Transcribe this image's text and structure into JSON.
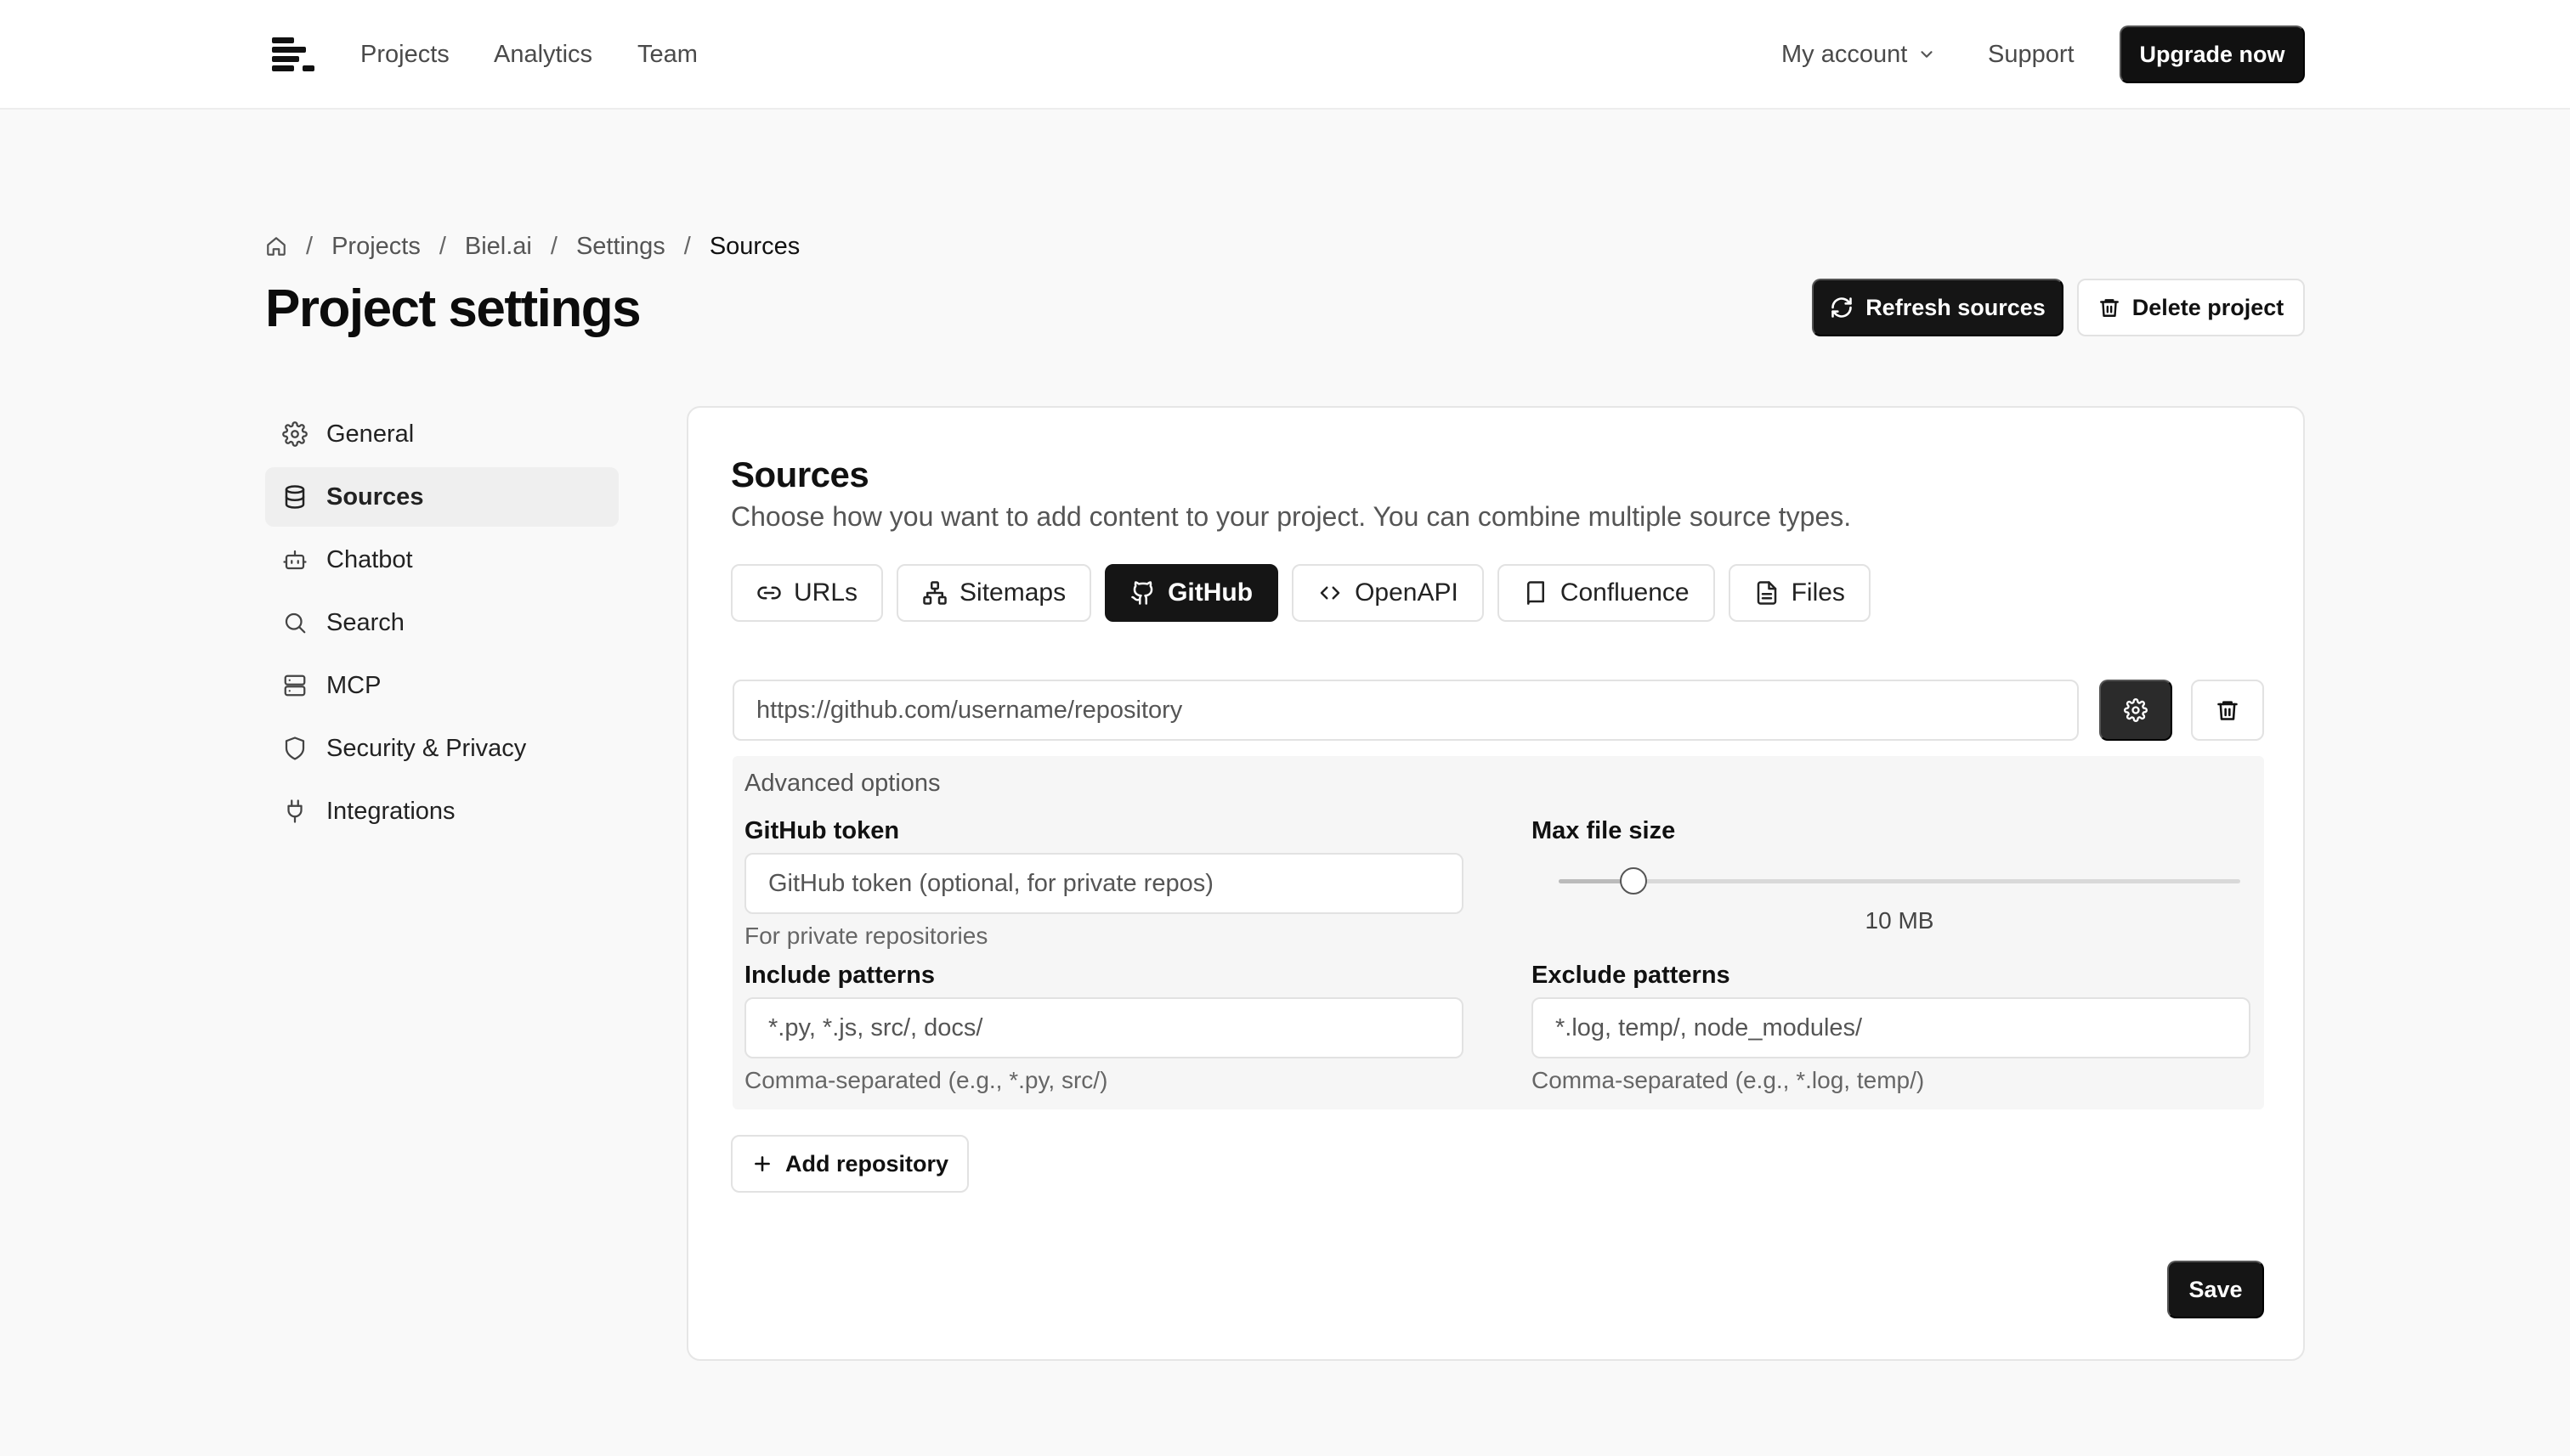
{
  "topnav": {
    "logo_icon": "menu-lines-logo",
    "links": [
      "Projects",
      "Analytics",
      "Team"
    ],
    "account_label": "My account",
    "support_label": "Support",
    "upgrade_label": "Upgrade now"
  },
  "breadcrumb": {
    "home_icon": "home-icon",
    "items": [
      "Projects",
      "Biel.ai",
      "Settings",
      "Sources"
    ]
  },
  "page": {
    "title": "Project settings",
    "refresh_label": "Refresh sources",
    "delete_label": "Delete project"
  },
  "sidebar": {
    "items": [
      {
        "label": "General",
        "icon": "gear-icon"
      },
      {
        "label": "Sources",
        "icon": "database-icon",
        "active": true
      },
      {
        "label": "Chatbot",
        "icon": "bot-icon"
      },
      {
        "label": "Search",
        "icon": "search-icon"
      },
      {
        "label": "MCP",
        "icon": "server-icon"
      },
      {
        "label": "Security & Privacy",
        "icon": "shield-icon"
      },
      {
        "label": "Integrations",
        "icon": "plug-icon"
      }
    ]
  },
  "sources": {
    "title": "Sources",
    "description": "Choose how you want to add content to your project. You can combine multiple source types.",
    "tabs": [
      {
        "label": "URLs",
        "icon": "link-icon"
      },
      {
        "label": "Sitemaps",
        "icon": "sitemap-icon"
      },
      {
        "label": "GitHub",
        "icon": "github-icon",
        "active": true
      },
      {
        "label": "OpenAPI",
        "icon": "code-icon"
      },
      {
        "label": "Confluence",
        "icon": "book-icon"
      },
      {
        "label": "Files",
        "icon": "file-icon"
      }
    ],
    "repo_placeholder": "https://github.com/username/repository",
    "advanced": {
      "title": "Advanced options",
      "token_label": "GitHub token",
      "token_placeholder": "GitHub token (optional, for private repos)",
      "token_help": "For private repositories",
      "max_size_label": "Max file size",
      "max_size_value": "10 MB",
      "max_size_fraction": 0.11,
      "include_label": "Include patterns",
      "include_placeholder": "*.py, *.js, src/, docs/",
      "include_help": "Comma-separated (e.g., *.py, src/)",
      "exclude_label": "Exclude patterns",
      "exclude_placeholder": "*.log, temp/, node_modules/",
      "exclude_help": "Comma-separated (e.g., *.log, temp/)"
    },
    "add_label": "Add repository",
    "save_label": "Save"
  },
  "colors": {
    "primary": "#151515",
    "background": "#f9f9f9",
    "border": "#e2e2e2"
  }
}
